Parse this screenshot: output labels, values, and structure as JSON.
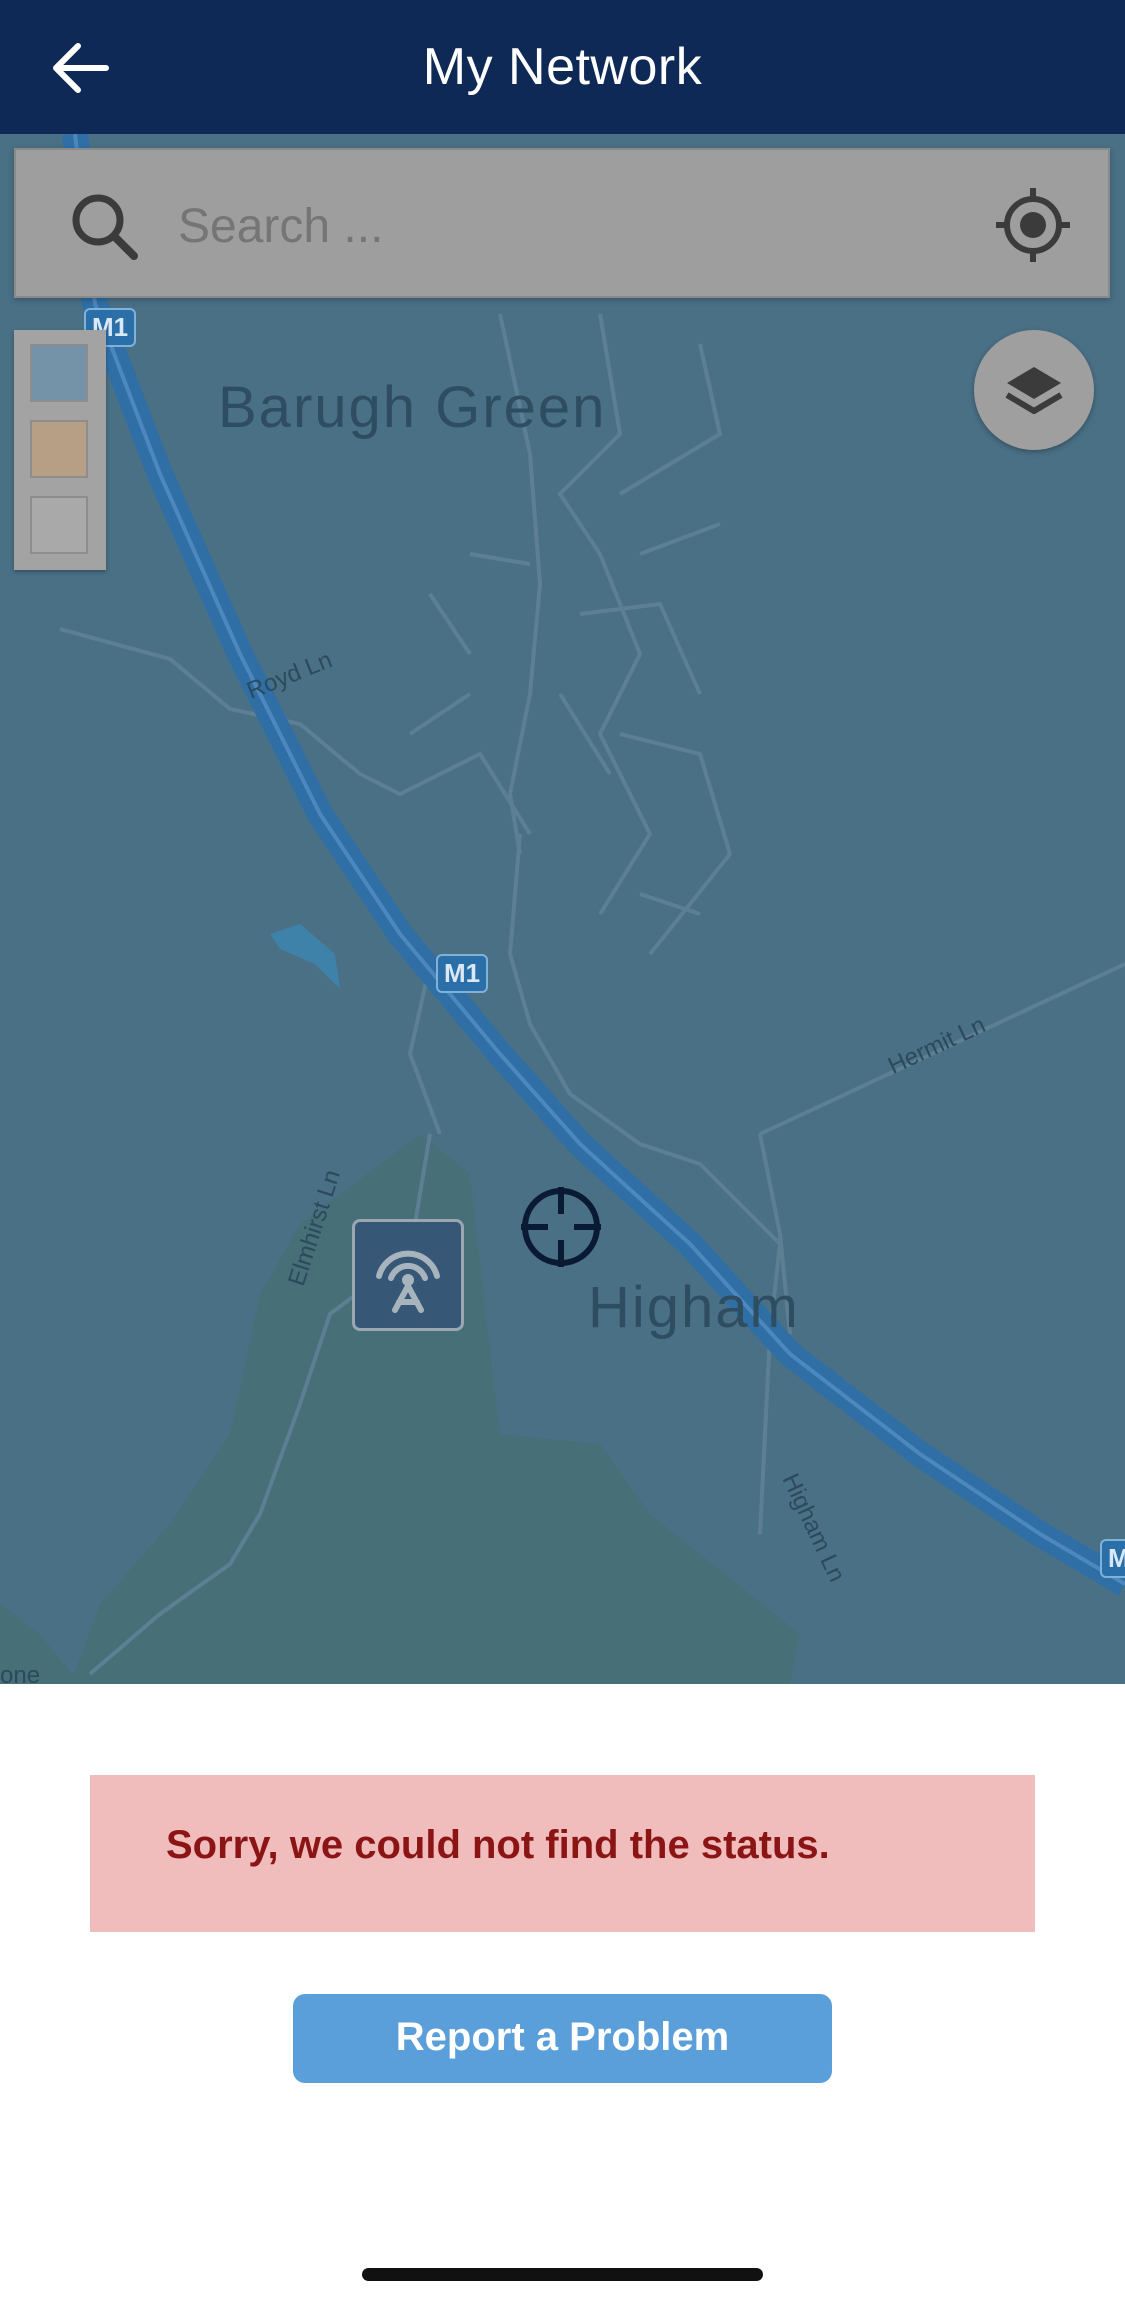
{
  "header": {
    "title": "My Network",
    "background": "#0f2957",
    "back_icon": "arrow-left-icon"
  },
  "search": {
    "placeholder": "Search ...",
    "search_icon": "magnifier-icon",
    "locate_icon": "crosshair-target-icon"
  },
  "map": {
    "places": [
      "Barugh Green",
      "Higham"
    ],
    "roads": [
      "Royd Ln",
      "Hermit Ln",
      "Elmhirst Ln",
      "Higham Ln"
    ],
    "motorway_shields": [
      "M1",
      "M1",
      "M"
    ],
    "partial_labels": [
      "one"
    ],
    "legend": {
      "swatches": [
        {
          "color": "#7493a8"
        },
        {
          "color": "#b79f86"
        },
        {
          "color": "#a9a9a9"
        }
      ]
    },
    "layers_icon": "layers-icon",
    "mast_icon": "signal-mast-icon",
    "center_icon": "crosshair-icon"
  },
  "status": {
    "message": "Sorry, we could not find the status.",
    "background": "#f1bcbc",
    "text_color": "#8b1515"
  },
  "actions": {
    "report_label": "Report a Problem",
    "report_color": "#5a9fd9"
  }
}
